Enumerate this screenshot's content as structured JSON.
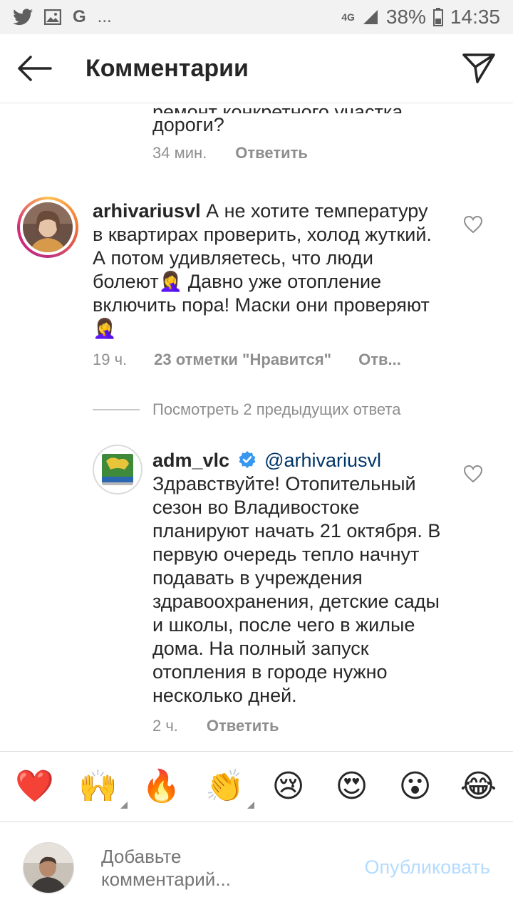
{
  "status_bar": {
    "battery": "38%",
    "time": "14:35",
    "network": "4G",
    "icons": [
      "twitter-icon",
      "gallery-icon",
      "google-icon",
      "more-dots"
    ]
  },
  "header": {
    "title": "Комментарии",
    "back_icon": "arrow-left-icon",
    "share_icon": "paper-plane-icon"
  },
  "comments": {
    "partial": {
      "text": "дороги?",
      "time": "34 мин.",
      "reply": "Ответить"
    },
    "first": {
      "username": "arhivariusvl",
      "text": "А не хотите температуру в квартирах проверить, холод жуткий. А потом удивляетесь, что люди болеют🤦‍♀️ Давно уже отопление включить пора! Маски они проверяют🤦‍♀️",
      "time": "19 ч.",
      "likes": "23 отметки \"Нравится\"",
      "reply": "Отв..."
    },
    "view_previous": "Посмотреть 2 предыдущих ответа",
    "reply_comment": {
      "username": "adm_vlc",
      "mention": "@arhivariusvl",
      "text": "Здравствуйте! Отопительный сезон во Владивостоке планируют начать 21 октября. В первую очередь тепло начнут подавать в учреждения здравоохранения, детские сады и школы, после чего в жилые дома. На полный запуск отопления в городе нужно несколько дней.",
      "time": "2 ч.",
      "reply": "Ответить"
    }
  },
  "emoji_bar": [
    "❤️",
    "🙌",
    "🔥",
    "👏",
    "😢",
    "😍",
    "😮",
    "😂"
  ],
  "input": {
    "placeholder": "Добавьте комментарий...",
    "publish": "Опубликовать"
  },
  "colors": {
    "text": "#262626",
    "secondary": "#8e8e8e",
    "mention": "#003569",
    "verified": "#3897f0",
    "publish_disabled": "#b3dbff"
  }
}
